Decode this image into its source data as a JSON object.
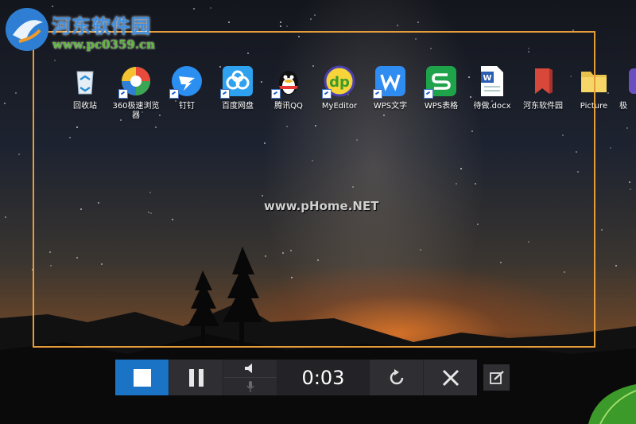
{
  "branding": {
    "site_title": "河东软件园",
    "site_url": "www.pc0359.cn",
    "watermark": "www.pHome.NET"
  },
  "desktop_icons": [
    {
      "label": "回收站",
      "icon": "recycle-bin-icon",
      "shortcut": false
    },
    {
      "label": "360极速浏览器",
      "icon": "360-browser-icon",
      "shortcut": true
    },
    {
      "label": "钉钉",
      "icon": "dingtalk-icon",
      "shortcut": true
    },
    {
      "label": "百度网盘",
      "icon": "baidu-netdisk-icon",
      "shortcut": true
    },
    {
      "label": "腾讯QQ",
      "icon": "qq-icon",
      "shortcut": true
    },
    {
      "label": "MyEditor",
      "icon": "myeditor-icon",
      "shortcut": true
    },
    {
      "label": "WPS文字",
      "icon": "wps-writer-icon",
      "shortcut": true
    },
    {
      "label": "WPS表格",
      "icon": "wps-spreadsheet-icon",
      "shortcut": true
    },
    {
      "label": "待做.docx",
      "icon": "word-doc-icon",
      "shortcut": false
    },
    {
      "label": "河东软件园",
      "icon": "red-bookmark-icon",
      "shortcut": false
    },
    {
      "label": "Picture",
      "icon": "folder-icon",
      "shortcut": false
    },
    {
      "label": "极",
      "icon": "partial-app-icon",
      "shortcut": false
    }
  ],
  "recorder": {
    "timer": "0:03",
    "stop": "stop-icon",
    "pause": "pause-icon",
    "speaker": "speaker-icon",
    "microphone": "microphone-icon",
    "restart": "restart-icon",
    "close": "close-icon",
    "annotate": "annotate-icon"
  },
  "colors": {
    "selection_border": "#e59c3a",
    "stop_button": "#1a73c5",
    "toolbar_bg": "#2f2f33",
    "site_title": "#3f8fe0",
    "site_url": "#61b73b"
  }
}
